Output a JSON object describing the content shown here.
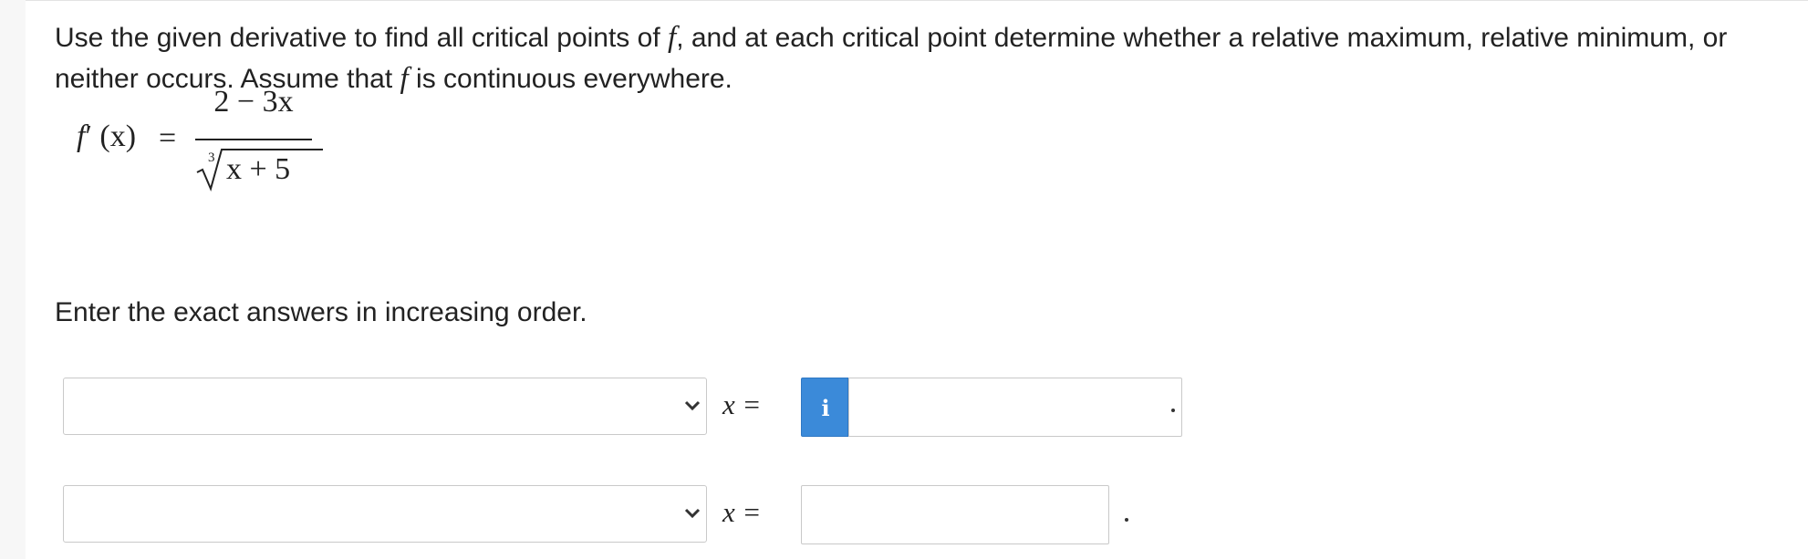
{
  "question": {
    "text_part1": "Use the given derivative to find all critical points of",
    "f1": "f",
    "text_part2": ", and at each critical point determine whether a relative maximum, relative minimum, or neither occurs. Assume that",
    "f2": "f",
    "text_part3": " is continuous everywhere."
  },
  "formula": {
    "lhs_f": "f",
    "lhs_rest": "′ (x)",
    "equals": "=",
    "numerator": "2 − 3x",
    "root_index": "3",
    "radicand": "x + 5"
  },
  "instruction": "Enter the exact answers in increasing order.",
  "answer_rows": [
    {
      "dropdown_value": "",
      "x_label": "x =",
      "answer_value": "",
      "punctuation": "."
    },
    {
      "dropdown_value": "",
      "x_label": "x =",
      "answer_value": "",
      "punctuation": "."
    }
  ],
  "info_button": {
    "glyph": "i",
    "icon": "info-icon",
    "color": "#3b8ad9"
  }
}
